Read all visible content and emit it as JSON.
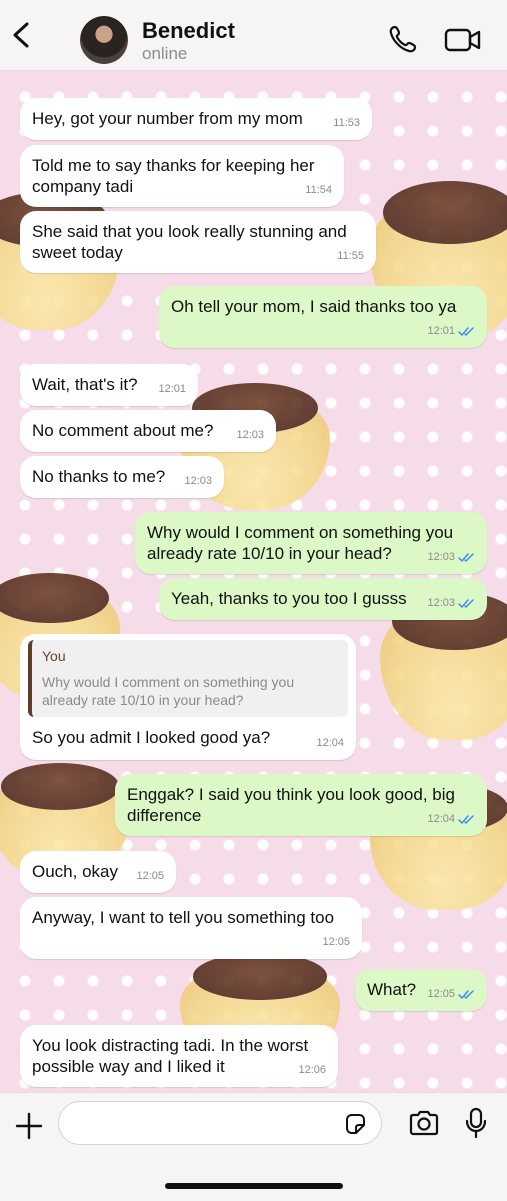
{
  "header": {
    "contact_name": "Benedict",
    "status": "online"
  },
  "messages": [
    {
      "text": "Hey, got your number from my mom",
      "time": "11:53"
    },
    {
      "text": "Told me to say thanks for keeping her company tadi",
      "time": "11:54"
    },
    {
      "text": "She said that you look really stunning and sweet today",
      "time": "11:55"
    },
    {
      "text": "Oh tell your mom, I said thanks too ya",
      "time": "12:01"
    },
    {
      "text": "Wait, that's it?",
      "time": "12:01"
    },
    {
      "text": "No comment about me?",
      "time": "12:03"
    },
    {
      "text": "No thanks to me?",
      "time": "12:03"
    },
    {
      "text": "Why would I comment on something you already rate 10/10 in your head?",
      "time": "12:03"
    },
    {
      "text": "Yeah, thanks to you too I gusss",
      "time": "12:03"
    },
    {
      "reply_author": "You",
      "reply_text": "Why would I comment on something you already rate 10/10 in your head?",
      "text": "So you admit I looked good ya?",
      "time": "12:04"
    },
    {
      "text": "Enggak? I said you think you look good, big difference",
      "time": "12:04"
    },
    {
      "text": "Ouch, okay",
      "time": "12:05"
    },
    {
      "text": "Anyway, I want to tell you something too",
      "time": "12:05"
    },
    {
      "text": "What?",
      "time": "12:05"
    },
    {
      "text": "You look distracting tadi. In the worst possible way and I liked it",
      "time": "12:06"
    }
  ],
  "colors": {
    "incoming_bubble": "#ffffff",
    "outgoing_bubble": "#dcf8c6",
    "read_receipt": "#3b8ef0"
  },
  "icons": [
    "back-chevron-icon",
    "phone-icon",
    "video-camera-icon",
    "plus-icon",
    "sticker-icon",
    "camera-icon",
    "microphone-icon",
    "double-check-icon"
  ]
}
